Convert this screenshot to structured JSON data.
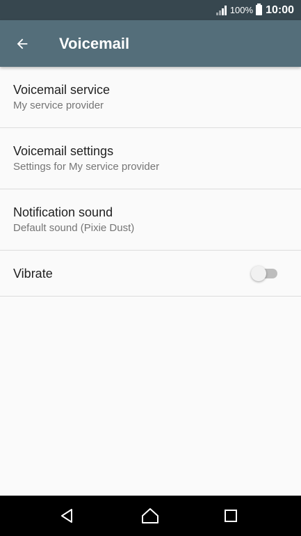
{
  "status_bar": {
    "battery_percent": "100%",
    "time": "10:00"
  },
  "app_bar": {
    "title": "Voicemail",
    "back_icon": "arrow-left-icon"
  },
  "settings": [
    {
      "title": "Voicemail service",
      "subtitle": "My service provider"
    },
    {
      "title": "Voicemail settings",
      "subtitle": "Settings for My service provider"
    },
    {
      "title": "Notification sound",
      "subtitle": "Default sound (Pixie Dust)"
    }
  ],
  "vibrate": {
    "label": "Vibrate",
    "enabled": false
  },
  "nav_bar": {
    "back_icon": "triangle-back-icon",
    "home_icon": "home-icon",
    "recents_icon": "square-recents-icon"
  },
  "colors": {
    "status_bar": "#37474f",
    "app_bar": "#546e7a",
    "background": "#fafafa",
    "nav_bar": "#000000"
  }
}
